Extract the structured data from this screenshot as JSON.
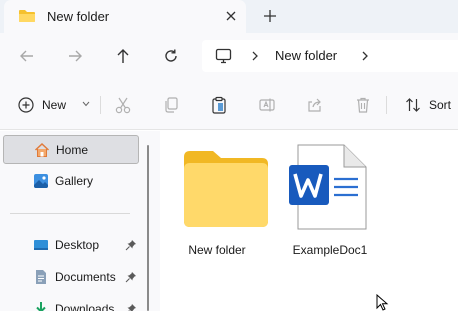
{
  "tab": {
    "title": "New folder",
    "icons": {
      "folder": "folder-icon",
      "close": "close-icon",
      "new_tab": "plus-icon"
    }
  },
  "navigation": {
    "buttons": [
      "back-arrow-icon",
      "forward-arrow-icon",
      "up-arrow-icon",
      "refresh-icon"
    ]
  },
  "address_bar": {
    "segments": [
      "New folder"
    ],
    "icons": {
      "root": "computer-icon",
      "separator": "chevron-right-icon"
    }
  },
  "command_bar": {
    "new_label": "New",
    "sort_label": "Sort",
    "actions": [
      "cut-icon",
      "copy-icon",
      "paste-icon",
      "rename-icon",
      "share-icon",
      "delete-icon"
    ]
  },
  "sidebar": {
    "items": [
      {
        "label": "Home",
        "icon": "home-icon",
        "selected": true,
        "pinned": false
      },
      {
        "label": "Gallery",
        "icon": "gallery-icon",
        "selected": false,
        "pinned": false
      },
      {
        "label": "Desktop",
        "icon": "desktop-icon",
        "selected": false,
        "pinned": true
      },
      {
        "label": "Documents",
        "icon": "documents-icon",
        "selected": false,
        "pinned": true
      },
      {
        "label": "Downloads",
        "icon": "download-icon",
        "selected": false,
        "pinned": true
      }
    ]
  },
  "files": [
    {
      "name": "New folder",
      "type": "folder",
      "icon": "folder-icon"
    },
    {
      "name": "ExampleDoc1",
      "type": "word-document",
      "icon": "word-document-icon"
    }
  ],
  "colors": {
    "tab_bar_bg": "#eef2f7",
    "chrome_bg": "#f9f9fb",
    "selected_bg": "#dedfe3",
    "folder_yellow": "#f5c12e",
    "word_blue": "#185abd"
  }
}
